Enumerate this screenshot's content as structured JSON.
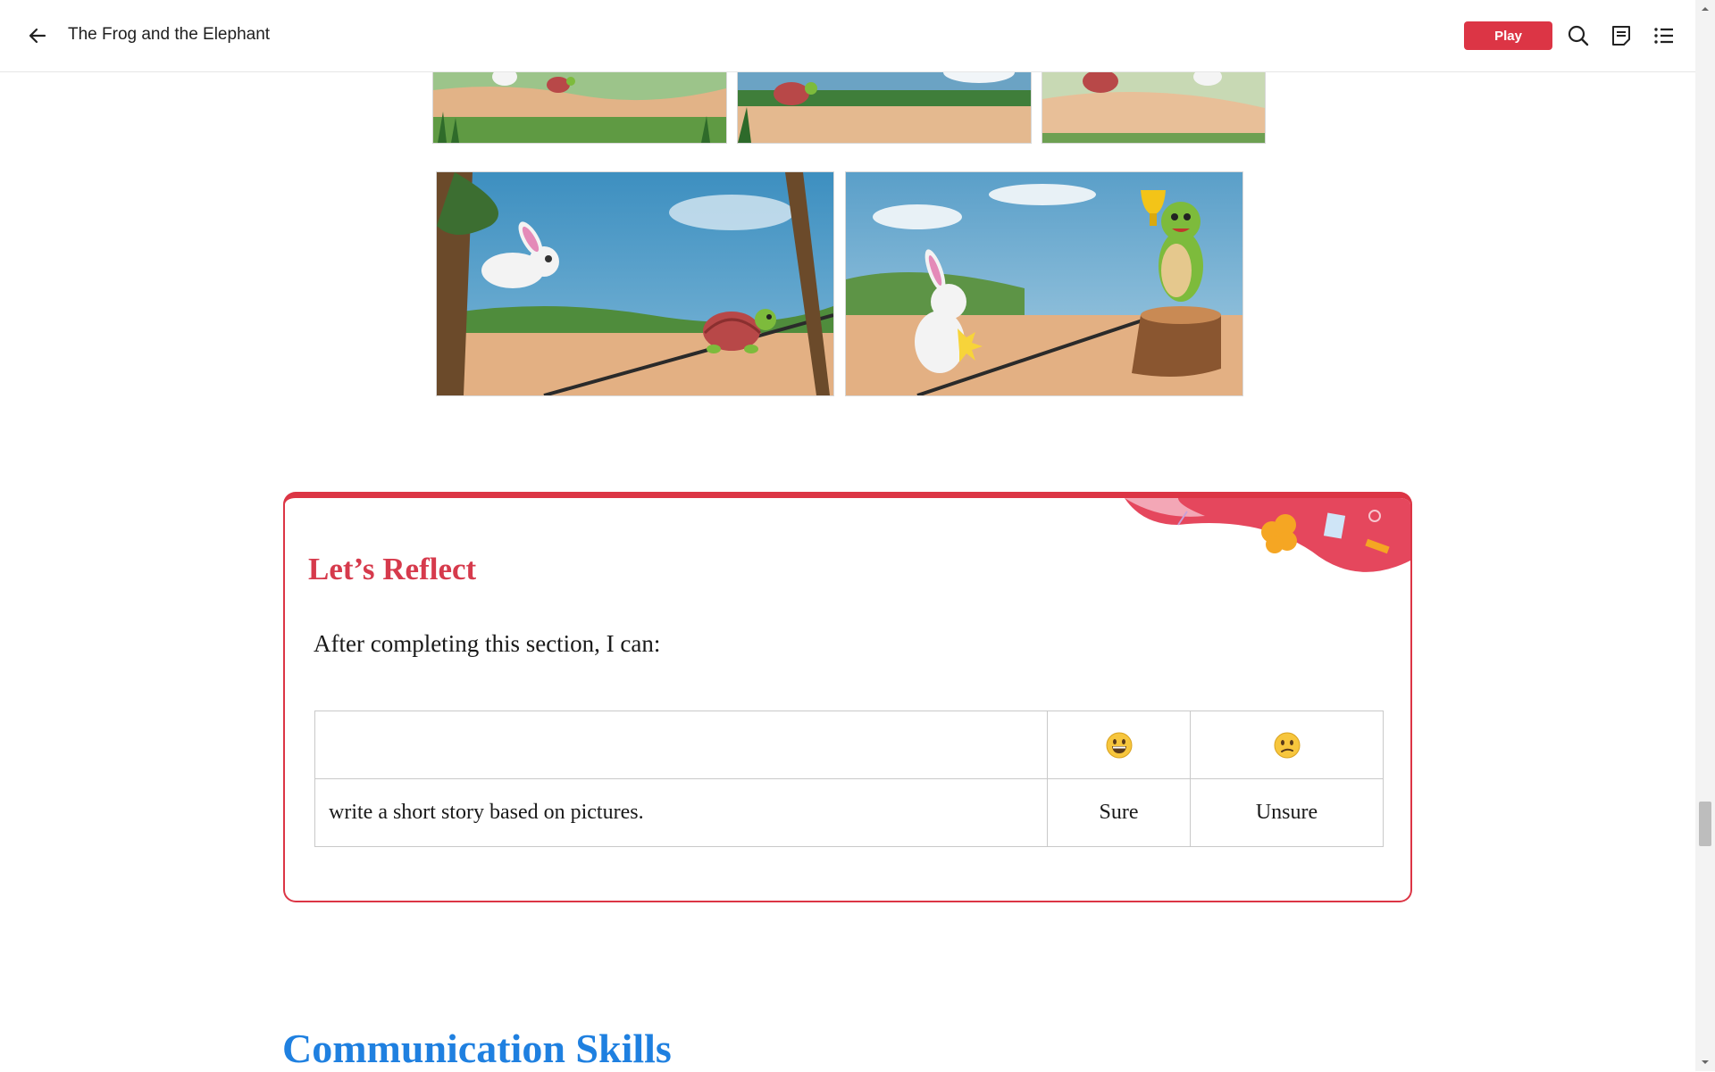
{
  "header": {
    "title": "The Frog and the Elephant",
    "play_label": "Play",
    "icons": [
      "back-arrow-icon",
      "search-icon",
      "notes-icon",
      "table-of-contents-icon"
    ]
  },
  "illustrations": [
    {
      "name": "hare-and-tortoise-race-scene-1"
    },
    {
      "name": "hare-and-tortoise-race-scene-2"
    },
    {
      "name": "hare-and-tortoise-race-scene-3"
    },
    {
      "name": "hare-leaping-past-tortoise"
    },
    {
      "name": "tortoise-winning-trophy"
    }
  ],
  "reflect": {
    "title": "Let’s Reflect",
    "intro": "After completing this section, I can:",
    "table": {
      "header_icons": [
        "smiling-face-icon",
        "confused-face-icon"
      ],
      "rows": [
        {
          "statement": "write a short story based on pictures.",
          "sure": "Sure",
          "unsure": "Unsure"
        }
      ]
    }
  },
  "next_section": {
    "heading": "Communication Skills"
  },
  "colors": {
    "accent": "#dc3545",
    "heading_blue": "#1f80e0"
  }
}
